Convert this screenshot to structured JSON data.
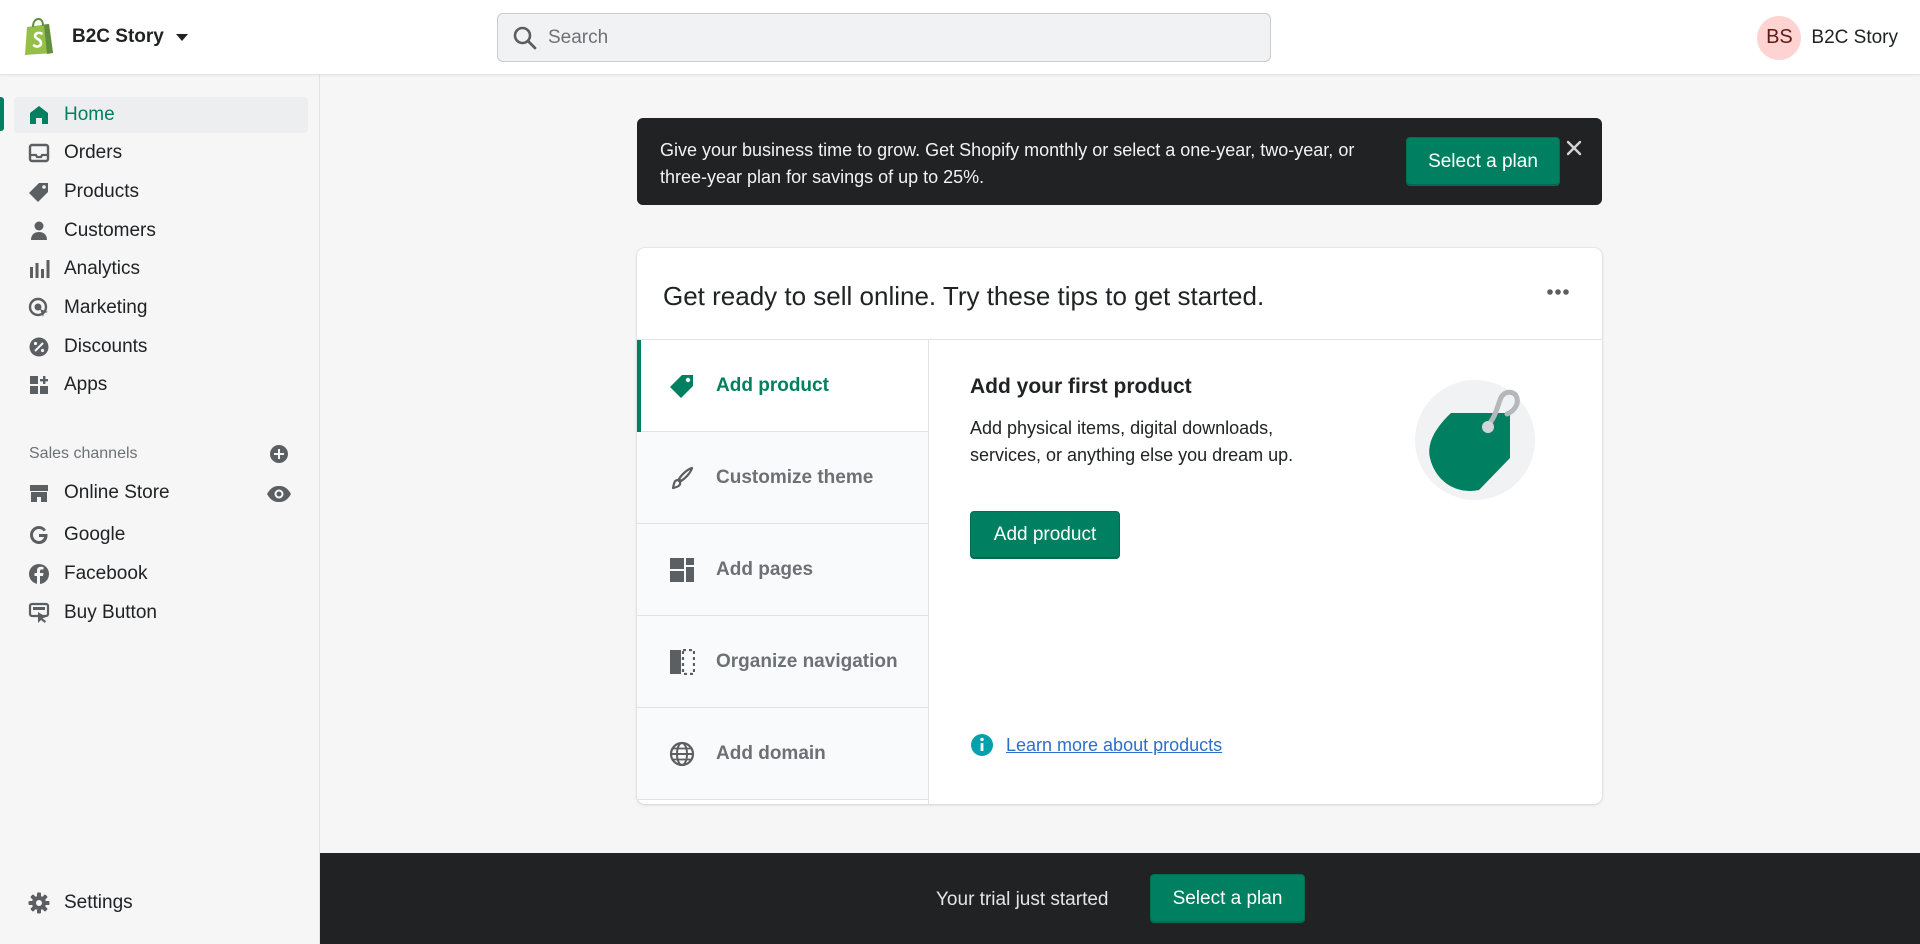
{
  "brand": {
    "store_name": "B2C Story",
    "logo_icon": "shopify-bag-icon",
    "accent_color": "#008060"
  },
  "search": {
    "placeholder": "Search"
  },
  "account": {
    "initials": "BS",
    "name": "B2C Story",
    "avatar_color": "#fed3d1"
  },
  "sidebar": {
    "items": [
      {
        "label": "Home",
        "icon": "home-icon",
        "active": true
      },
      {
        "label": "Orders",
        "icon": "orders-icon"
      },
      {
        "label": "Products",
        "icon": "tag-icon"
      },
      {
        "label": "Customers",
        "icon": "person-icon"
      },
      {
        "label": "Analytics",
        "icon": "bar-chart-icon"
      },
      {
        "label": "Marketing",
        "icon": "target-icon"
      },
      {
        "label": "Discounts",
        "icon": "discount-icon"
      },
      {
        "label": "Apps",
        "icon": "apps-icon"
      }
    ],
    "sales_channels_title": "Sales channels",
    "channels": [
      {
        "label": "Online Store",
        "icon": "store-icon"
      },
      {
        "label": "Google",
        "icon": "google-icon"
      },
      {
        "label": "Facebook",
        "icon": "facebook-icon"
      },
      {
        "label": "Buy Button",
        "icon": "buy-button-icon"
      }
    ],
    "settings_label": "Settings"
  },
  "banner": {
    "text": "Give your business time to grow. Get Shopify monthly or select a one-year, two-year, or three-year plan for savings of up to 25%.",
    "button_label": "Select a plan"
  },
  "setup_card": {
    "title": "Get ready to sell online. Try these tips to get started.",
    "tabs": [
      {
        "label": "Add product",
        "icon": "tag-icon",
        "active": true
      },
      {
        "label": "Customize theme",
        "icon": "brush-icon"
      },
      {
        "label": "Add pages",
        "icon": "pages-icon"
      },
      {
        "label": "Organize navigation",
        "icon": "navigation-icon"
      },
      {
        "label": "Add domain",
        "icon": "globe-icon"
      }
    ],
    "panel": {
      "title": "Add your first product",
      "description": "Add physical items, digital downloads, services, or anything else you dream up.",
      "button_label": "Add product",
      "learn_more": "Learn more about products"
    }
  },
  "trial_bar": {
    "text": "Your trial just started",
    "button_label": "Select a plan"
  }
}
